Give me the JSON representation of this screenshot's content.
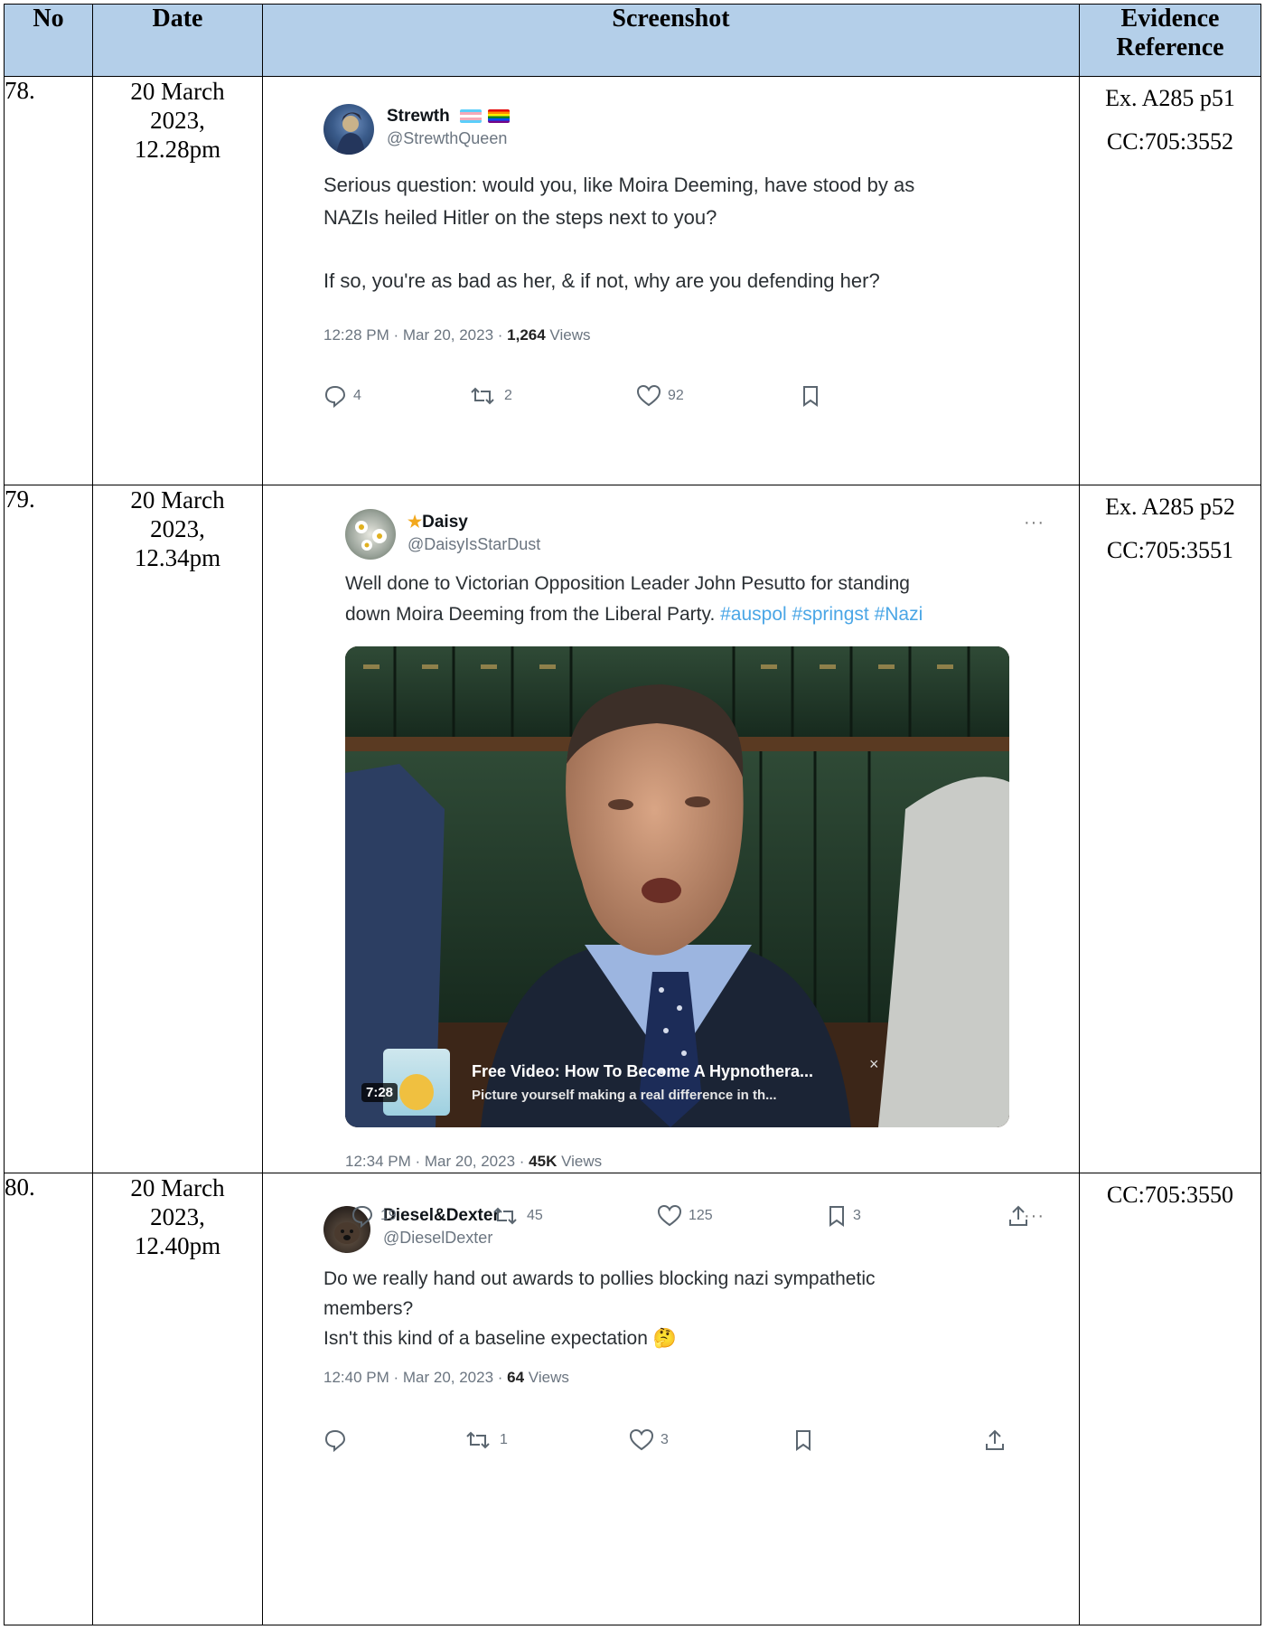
{
  "header": {
    "no": "No",
    "date": "Date",
    "screenshot": "Screenshot",
    "evidence_line1": "Evidence",
    "evidence_line2": "Reference"
  },
  "rows": [
    {
      "no": "78.",
      "date_line1": "20 March",
      "date_line2": "2023,",
      "date_line3": "12.28pm",
      "ref_line1": "Ex. A285 p51",
      "ref_line2": "CC:705:3552",
      "tweet": {
        "name": "Strewth",
        "badges": [
          "trans-flag-icon",
          "rainbow-flag-icon"
        ],
        "handle": "@StrewthQueen",
        "body_line1": "Serious question: would you, like Moira Deeming, have stood by as",
        "body_line2": "NAZIs heiled Hitler on the steps next to you?",
        "body_line3": "If so, you're as bad as her, & if not, why are you defending her?",
        "meta_prefix": "12:28 PM · Mar 20, 2023 · ",
        "views_count": "1,264",
        "views_label": " Views",
        "replies": "4",
        "retweets": "2",
        "likes": "92",
        "bookmarks": ""
      }
    },
    {
      "no": "79.",
      "date_line1": "20 March",
      "date_line2": "2023,",
      "date_line3": "12.34pm",
      "ref_line1": "Ex. A285 p52",
      "ref_line2": "CC:705:3551",
      "tweet": {
        "name": "Daisy",
        "handle": "@DaisyIsStarDust",
        "more": "···",
        "body_line1": "Well done to Victorian Opposition Leader John Pesutto for standing",
        "body_line2_plain": "down Moira Deeming from the Liberal Party. ",
        "hashtags": "#auspol #springst #Nazi",
        "video": {
          "duration": "7:28",
          "ad_title": "Free Video: How To Become A Hypnothera...",
          "ad_subtitle": "Picture yourself making a real difference in th...",
          "close": "×"
        },
        "meta_prefix": "12:34 PM · Mar 20, 2023 · ",
        "views_count": "45K",
        "views_label": " Views",
        "replies": "19",
        "retweets": "45",
        "likes": "125",
        "bookmarks": "3"
      }
    },
    {
      "no": "80.",
      "date_line1": "20 March",
      "date_line2": "2023,",
      "date_line3": "12.40pm",
      "ref_line1": "CC:705:3550",
      "ref_line2": "",
      "tweet": {
        "name": "Diesel&Dexter",
        "handle": "@DieselDexter",
        "more": "···",
        "body_line1": "Do we really hand out awards to pollies blocking nazi sympathetic",
        "body_line2": "members?",
        "body_line3": "Isn't this kind of a baseline expectation",
        "emoji": "🤔",
        "meta_prefix": "12:40 PM · Mar 20, 2023 · ",
        "views_count": "64",
        "views_label": " Views",
        "replies": "",
        "retweets": "1",
        "likes": "3",
        "bookmarks": ""
      }
    }
  ]
}
